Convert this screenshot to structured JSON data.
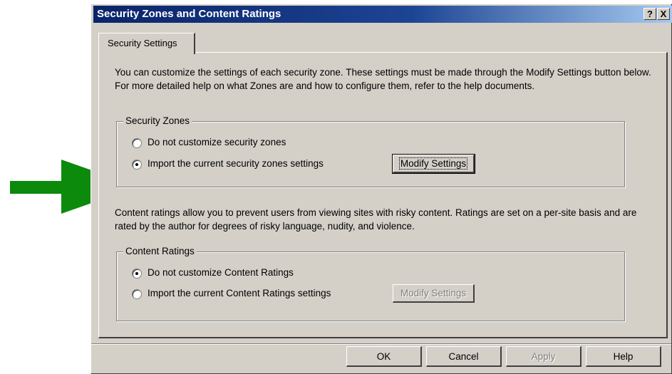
{
  "window": {
    "title": "Security Zones and Content Ratings",
    "help_btn": "?",
    "close_btn": "X"
  },
  "tabs": [
    {
      "label": "Security Settings",
      "active": true
    }
  ],
  "intro_text": "You can customize the settings of each security zone. These settings must be made through the Modify Settings button below. For more detailed help on what Zones are and how to configure them, refer to the help documents.",
  "security_zones": {
    "label": "Security Zones",
    "options": [
      {
        "label": "Do not customize security zones",
        "checked": false
      },
      {
        "label": "Import the current security zones settings",
        "checked": true
      }
    ],
    "modify_button": "Modify Settings"
  },
  "ratings_text": "Content ratings allow you to prevent users from viewing sites with risky content. Ratings are set on a per-site basis and are rated by the author for degrees of risky language, nudity, and violence.",
  "content_ratings": {
    "label": "Content Ratings",
    "options": [
      {
        "label": "Do not customize Content Ratings",
        "checked": true
      },
      {
        "label": "Import the current Content Ratings settings",
        "checked": false
      }
    ],
    "modify_button": "Modify Settings"
  },
  "footer": {
    "ok": "OK",
    "cancel": "Cancel",
    "apply": "Apply",
    "help": "Help"
  },
  "colors": {
    "arrow": "#0c8a0c",
    "title_start": "#0a246a",
    "title_end": "#a6caf0",
    "face": "#d4d0c8"
  },
  "icons": [
    "pointer-arrow-icon",
    "help-icon",
    "close-icon"
  ]
}
